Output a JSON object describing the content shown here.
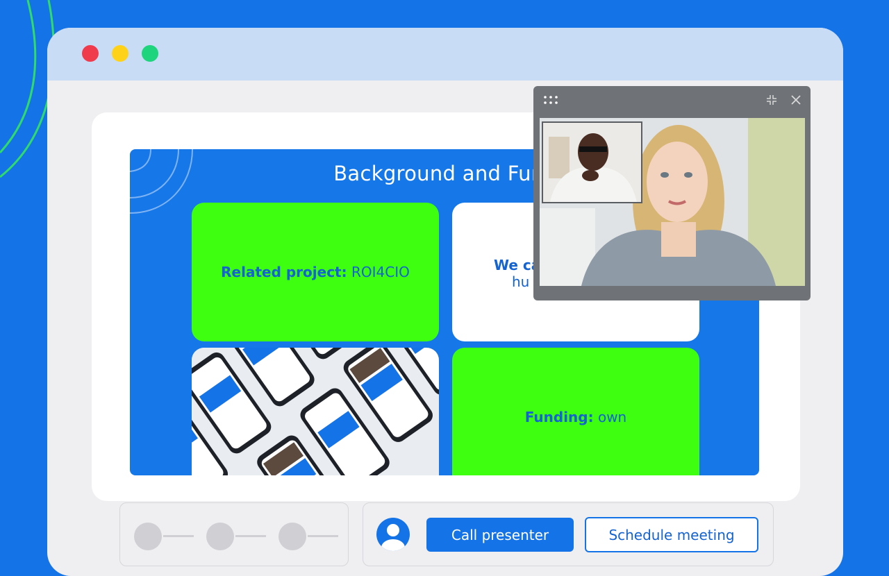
{
  "window_controls": {
    "close_color": "#f03b4d",
    "minimize_color": "#ffd21a",
    "maximize_color": "#1ed47c"
  },
  "slide": {
    "title": "Background and Func",
    "tiles": {
      "related": {
        "bold": "Related project:",
        "text": " ROI4CIO"
      },
      "we": {
        "line1": "We ca",
        "line2": "hu"
      },
      "funding": {
        "bold": "Funding:",
        "text": " own"
      }
    }
  },
  "video_call": {
    "icons": {
      "drag": "drag-handle-icon",
      "collapse": "collapse-icon",
      "close": "close-icon"
    }
  },
  "actions": {
    "call_label": "Call presenter",
    "schedule_label": "Schedule meeting",
    "avatar_icon": "user-avatar-icon"
  },
  "colors": {
    "background": "#1573e8",
    "accent_green": "#3dff0f",
    "text_blue": "#1463d1"
  }
}
